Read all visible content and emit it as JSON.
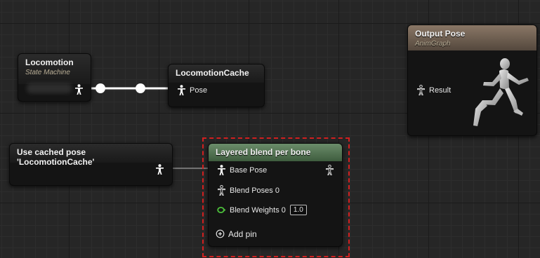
{
  "nodes": {
    "locomotion": {
      "title": "Locomotion",
      "subtitle": "State Machine"
    },
    "locomotion_cache": {
      "title": "LocomotionCache",
      "pose_label": "Pose"
    },
    "output_pose": {
      "title": "Output Pose",
      "subtitle": "AnimGraph",
      "result_label": "Result"
    },
    "use_cached_pose": {
      "title": "Use cached pose 'LocomotionCache'"
    },
    "layered_blend": {
      "title": "Layered blend per bone",
      "base_pose_label": "Base Pose",
      "blend_poses_label": "Blend Poses 0",
      "blend_weights_label": "Blend Weights 0",
      "blend_weights_value": "1.0",
      "add_pin_label": "Add pin"
    }
  },
  "colors": {
    "graph_background": "#262626",
    "wire": "#ffffff",
    "selection_outline": "#d11f1f",
    "float_pin": "#4cbf3b"
  },
  "icons": {
    "pose_pin": "pose-pin-icon",
    "float_pin": "float-pin-icon",
    "add_pin": "plus-circle-icon",
    "preview": "running-mannequin-icon"
  }
}
